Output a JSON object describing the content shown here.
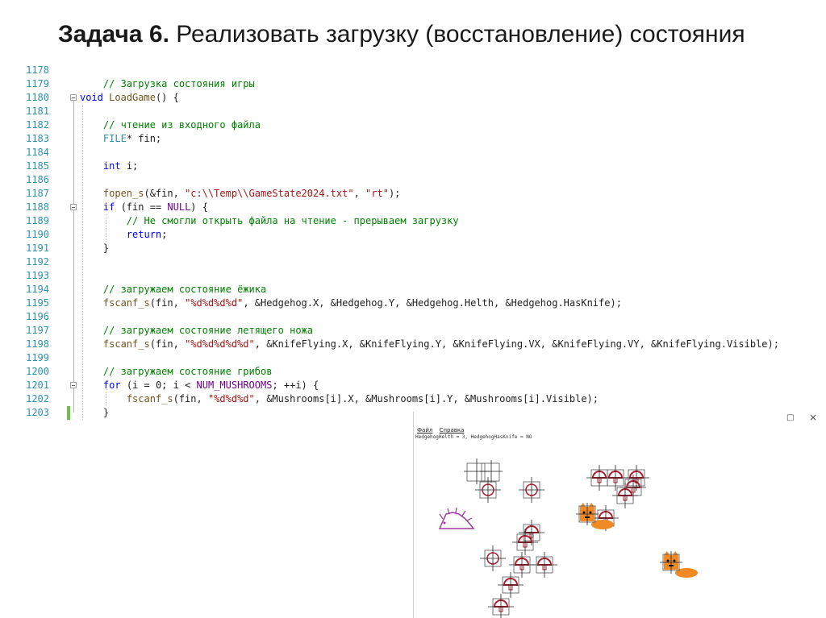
{
  "slide": {
    "title_bold": "Задача 6.",
    "title_rest": " Реализовать загрузку (восстановление) состояния"
  },
  "code": {
    "lines": [
      {
        "num": "1178",
        "tokens": []
      },
      {
        "num": "1179",
        "tokens": [
          {
            "t": "    "
          },
          {
            "t": "// Загрузка состояния игры",
            "c": "cm"
          }
        ]
      },
      {
        "num": "1180",
        "tokens": [
          {
            "t": "void",
            "c": "kw"
          },
          {
            "t": " "
          },
          {
            "t": "LoadGame",
            "c": "fn"
          },
          {
            "t": "() {"
          }
        ]
      },
      {
        "num": "1181",
        "tokens": []
      },
      {
        "num": "1182",
        "tokens": [
          {
            "t": "    "
          },
          {
            "t": "// чтение из входного файла",
            "c": "cm"
          }
        ]
      },
      {
        "num": "1183",
        "tokens": [
          {
            "t": "    "
          },
          {
            "t": "FILE",
            "c": "ty"
          },
          {
            "t": "* fin;"
          }
        ]
      },
      {
        "num": "1184",
        "tokens": []
      },
      {
        "num": "1185",
        "tokens": [
          {
            "t": "    "
          },
          {
            "t": "int",
            "c": "kw"
          },
          {
            "t": " i;"
          }
        ]
      },
      {
        "num": "1186",
        "tokens": []
      },
      {
        "num": "1187",
        "tokens": [
          {
            "t": "    "
          },
          {
            "t": "fopen_s",
            "c": "fn"
          },
          {
            "t": "(&fin, "
          },
          {
            "t": "\"c:\\\\Temp\\\\GameState2024.txt\"",
            "c": "st"
          },
          {
            "t": ", "
          },
          {
            "t": "\"rt\"",
            "c": "st"
          },
          {
            "t": ");"
          }
        ]
      },
      {
        "num": "1188",
        "tokens": [
          {
            "t": "    "
          },
          {
            "t": "if",
            "c": "kw"
          },
          {
            "t": " (fin == "
          },
          {
            "t": "NULL",
            "c": "mc"
          },
          {
            "t": ") {"
          }
        ]
      },
      {
        "num": "1189",
        "tokens": [
          {
            "t": "        "
          },
          {
            "t": "// Не смогли открыть файла на чтение - прерываем загрузку",
            "c": "cm"
          }
        ]
      },
      {
        "num": "1190",
        "tokens": [
          {
            "t": "        "
          },
          {
            "t": "return",
            "c": "kw"
          },
          {
            "t": ";"
          }
        ]
      },
      {
        "num": "1191",
        "tokens": [
          {
            "t": "    }"
          }
        ]
      },
      {
        "num": "1192",
        "tokens": []
      },
      {
        "num": "1193",
        "tokens": []
      },
      {
        "num": "1194",
        "tokens": [
          {
            "t": "    "
          },
          {
            "t": "// загружаем состояние ёжика",
            "c": "cm"
          }
        ]
      },
      {
        "num": "1195",
        "tokens": [
          {
            "t": "    "
          },
          {
            "t": "fscanf_s",
            "c": "fn"
          },
          {
            "t": "(fin, "
          },
          {
            "t": "\"%d%d%d%d\"",
            "c": "st"
          },
          {
            "t": ", &Hedgehog.X, &Hedgehog.Y, &Hedgehog.Helth, &Hedgehog.HasKnife);"
          }
        ]
      },
      {
        "num": "1196",
        "tokens": []
      },
      {
        "num": "1197",
        "tokens": [
          {
            "t": "    "
          },
          {
            "t": "// загружаем состояние летящего ножа",
            "c": "cm"
          }
        ]
      },
      {
        "num": "1198",
        "tokens": [
          {
            "t": "    "
          },
          {
            "t": "fscanf_s",
            "c": "fn"
          },
          {
            "t": "(fin, "
          },
          {
            "t": "\"%d%d%d%d%d\"",
            "c": "st"
          },
          {
            "t": ", &KnifeFlying.X, &KnifeFlying.Y, &KnifeFlying.VX, &KnifeFlying.VY, &KnifeFlying.Visible);"
          }
        ]
      },
      {
        "num": "1199",
        "tokens": []
      },
      {
        "num": "1200",
        "tokens": [
          {
            "t": "    "
          },
          {
            "t": "// загружаем состояние грибов",
            "c": "cm"
          }
        ]
      },
      {
        "num": "1201",
        "tokens": [
          {
            "t": "    "
          },
          {
            "t": "for",
            "c": "kw"
          },
          {
            "t": " (i = 0; i < "
          },
          {
            "t": "NUM_MUSHROOMS",
            "c": "mc"
          },
          {
            "t": "; ++i) {"
          }
        ]
      },
      {
        "num": "1202",
        "tokens": [
          {
            "t": "        "
          },
          {
            "t": "fscanf_s",
            "c": "fn"
          },
          {
            "t": "(fin, "
          },
          {
            "t": "\"%d%d%d\"",
            "c": "st"
          },
          {
            "t": ", &Mushrooms[i].X, &Mushrooms[i].Y, &Mushrooms[i].Visible);"
          }
        ]
      },
      {
        "num": "1203",
        "tokens": [
          {
            "t": "    }"
          }
        ]
      }
    ]
  },
  "game_window": {
    "menu": [
      "Файл",
      "Справка"
    ],
    "status": "HedgehogHelth = 3, HedgehogHasKnife = NO",
    "restore_icon": "□",
    "close_icon": "×",
    "colors": {
      "mushroom": "#b01c2c",
      "cat": "#f08a24",
      "hedgehog": "#9b3aa0",
      "box": "#555555",
      "cross": "#222222"
    }
  }
}
